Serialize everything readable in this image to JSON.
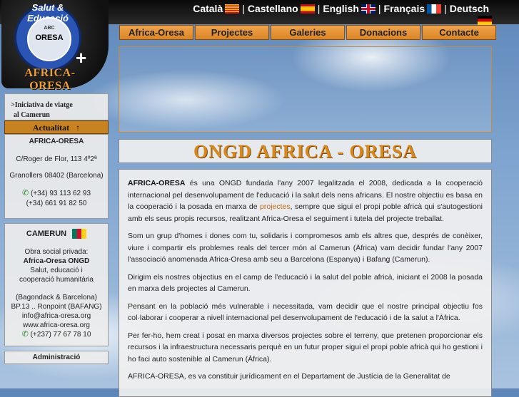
{
  "logo": {
    "ring_text": "Salut & Educació",
    "abc": "ABC",
    "oresa": "ORESA",
    "plus": "+",
    "title": "AFRICA-ORESA"
  },
  "languages": [
    {
      "label": "Català",
      "flag": "catalonia-flag"
    },
    {
      "label": "Castellano",
      "flag": "spain-flag"
    },
    {
      "label": "English",
      "flag": "uk-flag"
    },
    {
      "label": "Français",
      "flag": "france-flag"
    },
    {
      "label": "Deutsch",
      "flag": "germany-flag"
    }
  ],
  "nav": [
    "Africa-Oresa",
    "Projectes",
    "Galeries",
    "Donacions",
    "Contacte"
  ],
  "sidebar": {
    "link_line1": ">Iniciativa de viatge",
    "link_line2": "al Camerun",
    "actualitat": "Actualitat",
    "actualitat_arrow": "↑",
    "address": {
      "name": "AFRICA-ORESA",
      "street": "C/Roger de Flor, 113 4º2ª",
      "city": "Granollers 08402 (Barcelona)",
      "phone1": "(+34) 93 113 62 93",
      "phone2": "(+34) 661 91 82 50"
    },
    "camerun": {
      "title": "CAMERUN",
      "l1": "Obra social privada:",
      "l2": "Africa-Oresa ONGD",
      "l3": "Salut, educació i",
      "l4": "cooperació humanitària",
      "l5": "(Bagondack & Barcelona)",
      "l6": "BP.13 .. Ronpoint (BAFANG)",
      "l7": "info@africa-oresa.org",
      "l8": "www.africa-oresa.org",
      "phone": "(+237) 77 67 78 10"
    },
    "admin": "Administració"
  },
  "main": {
    "title": "ONGD  AFRICA - ORESA",
    "p1_bold": "AFRICA-ORESA",
    "p1_a": " és una ONGD fundada l'any 2007 legalitzada el 2008, dedicada a la cooperació internacional pel desenvolupament de l'educació i la salut dels nens africans. El nostre objectiu es basa en la cooperació i la posada en marxa de ",
    "p1_link": "projectes",
    "p1_b": ", sempre que sigui el propi poble africà qui s'autogestioni amb els seus propis recursos, realitzant Africa-Oresa el seguiment i tutela del projecte treballat.",
    "p2": "Som un grup d'homes i dones com tu, solidaris i compromesos amb els altres que, després de conèixer, viure i compartir els problemes reals del tercer món al Camerun (Àfrica) vam decidir fundar l'any 2007 l'associació anomenada Africa-Oresa amb seu a Barcelona (Espanya) i Bafang (Camerun).",
    "p3": "Dirigim els nostres objectius en el camp de l'educació i la salut del poble africà, iniciant el 2008 la posada en marxa dels projectes al Camerun.",
    "p4": "Pensant en la població més vulnerable i necessitada, vam decidir que el nostre principal objectiu fos col·laborar i cooperar a nivell internacional pel desenvolupament de l'educació i de la salut a l'Àfrica.",
    "p5": "Per fer-ho, hem creat i posat en marxa diversos projectes sobre el terreny, que pretenen proporcionar els recursos i la infraestructura necessaris perquè en un futur proper sigui el propi poble africà qui ho gestioni i ho faci auto sostenible al Camerun (Àfrica).",
    "p6": "AFRICA-ORESA, es va constituir jurídicament en el Departament de Justícia de la Generalitat de"
  }
}
